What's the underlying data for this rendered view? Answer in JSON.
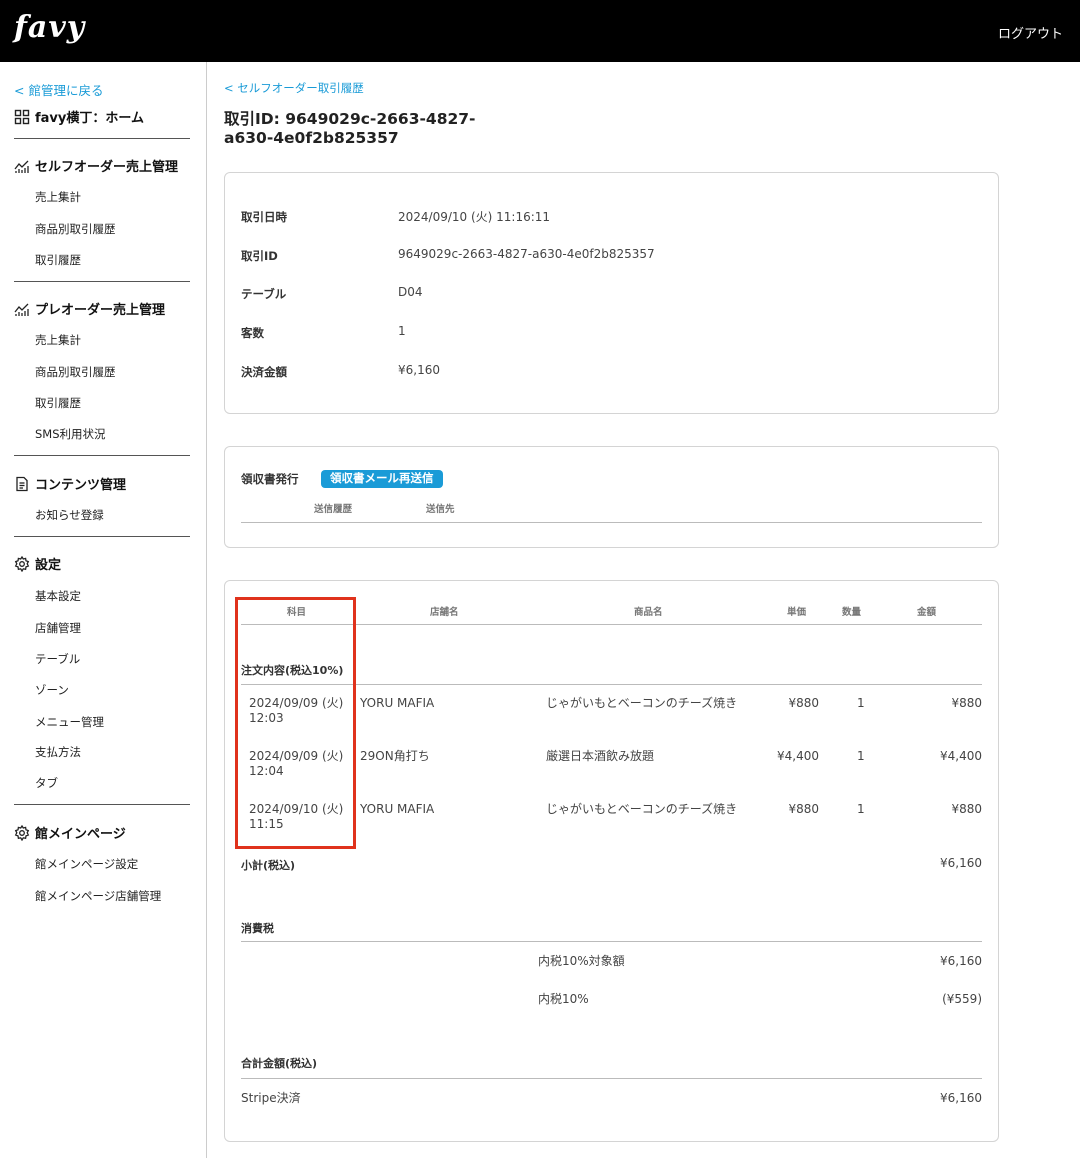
{
  "header": {
    "logo": "favy",
    "logout_label": "ログアウト"
  },
  "sidebar": {
    "back_label": "< 館管理に戻る",
    "home_label": "favy横丁：ホーム",
    "sections": [
      {
        "title": "セルフオーダー売上管理",
        "items": [
          "売上集計",
          "商品別取引履歴",
          "取引履歴"
        ]
      },
      {
        "title": "プレオーダー売上管理",
        "items": [
          "売上集計",
          "商品別取引履歴",
          "取引履歴",
          "SMS利用状況"
        ]
      },
      {
        "title": "コンテンツ管理",
        "items": [
          "お知らせ登録"
        ]
      },
      {
        "title": "設定",
        "items": [
          "基本設定",
          "店舗管理",
          "テーブル",
          "ゾーン",
          "メニュー管理",
          "支払方法",
          "タブ"
        ]
      },
      {
        "title": "館メインページ",
        "items": [
          "館メインページ設定",
          "館メインページ店舗管理"
        ]
      }
    ]
  },
  "main": {
    "breadcrumb": "< セルフオーダー取引履歴",
    "title": "取引ID: 9649029c-2663-4827-a630-4e0f2b825357",
    "summary": [
      {
        "label": "取引日時",
        "value": "2024/09/10 (火) 11:16:11"
      },
      {
        "label": "取引ID",
        "value": "9649029c-2663-4827-a630-4e0f2b825357"
      },
      {
        "label": "テーブル",
        "value": "D04"
      },
      {
        "label": "客数",
        "value": "1"
      },
      {
        "label": "決済金額",
        "value": "¥6,160"
      }
    ],
    "receipt": {
      "label": "領収書発行",
      "resend_button": "領収書メール再送信",
      "col_history": "送信履歴",
      "col_destination": "送信先"
    },
    "detail": {
      "headers": {
        "subject": "科目",
        "store": "店舗名",
        "product": "商品名",
        "unit_price": "単価",
        "qty": "数量",
        "amount": "金額"
      },
      "order_section": "注文内容(税込10%)",
      "rows": [
        {
          "date": "2024/09/09 (火)",
          "time": "12:03",
          "store": "YORU MAFIA",
          "product": "じゃがいもとベーコンのチーズ焼き",
          "unit_price": "¥880",
          "qty": "1",
          "amount": "¥880"
        },
        {
          "date": "2024/09/09 (火)",
          "time": "12:04",
          "store": "29ON角打ち",
          "product": "厳選日本酒飲み放題",
          "unit_price": "¥4,400",
          "qty": "1",
          "amount": "¥4,400"
        },
        {
          "date": "2024/09/10 (火)",
          "time": "11:15",
          "store": "YORU MAFIA",
          "product": "じゃがいもとベーコンのチーズ焼き",
          "unit_price": "¥880",
          "qty": "1",
          "amount": "¥880"
        }
      ],
      "subtotal_label": "小計(税込)",
      "subtotal_value": "¥6,160",
      "tax_label": "消費税",
      "tax_rows": [
        {
          "label": "内税10%対象額",
          "value": "¥6,160"
        },
        {
          "label": "内税10%",
          "value": "(¥559)"
        }
      ],
      "total_label": "合計金額(税込)",
      "payment_method": "Stripe決済",
      "total_value": "¥6,160"
    }
  },
  "colors": {
    "accent": "#1a9bd7",
    "highlight": "#e0321c",
    "topbar": "#000000"
  }
}
